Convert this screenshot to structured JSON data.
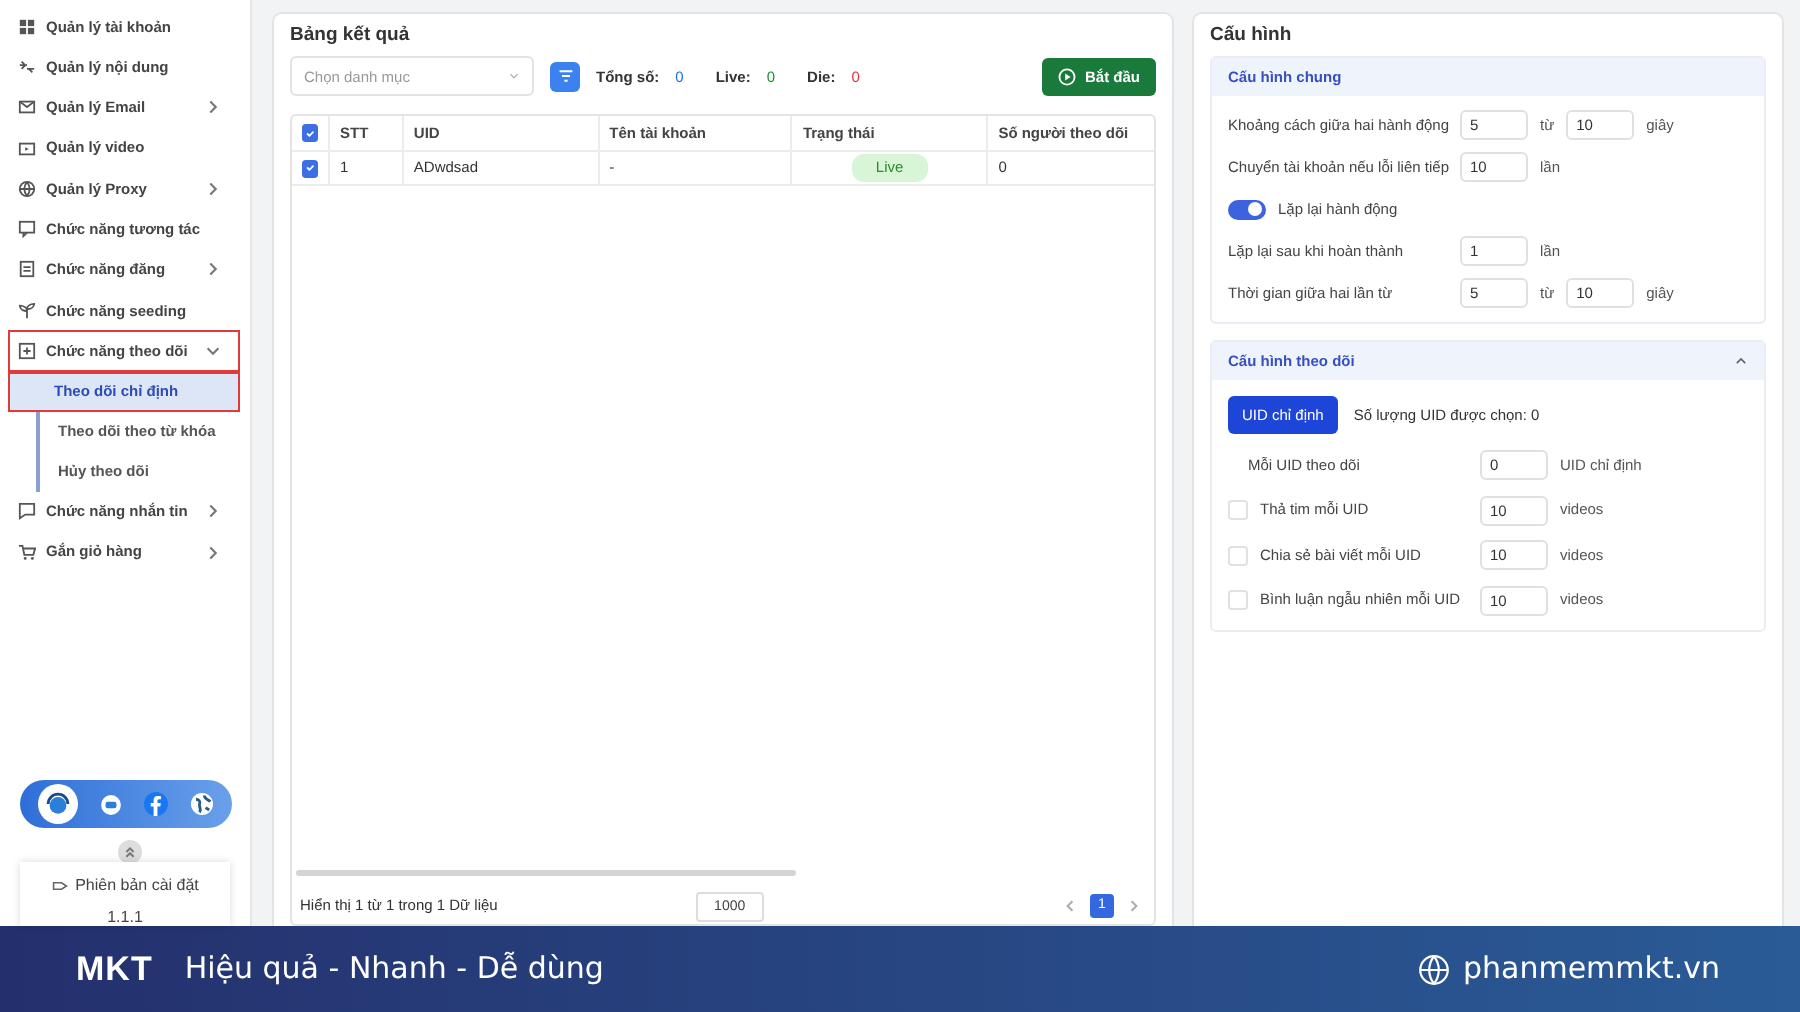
{
  "sidebar": {
    "items": [
      {
        "label": "Quản lý tài khoản",
        "outlined": false
      },
      {
        "label": "Quản lý nội dung",
        "outlined": false
      },
      {
        "label": "Quản lý Email",
        "expanded": false,
        "outlined": false
      },
      {
        "label": "Quản lý video",
        "outlined": false
      },
      {
        "label": "Quản lý Proxy",
        "expanded": false,
        "outlined": false
      },
      {
        "label": "Chức năng tương tác",
        "outlined": false
      },
      {
        "label": "Chức năng đăng",
        "expanded": false,
        "outlined": false
      },
      {
        "label": "Chức năng seeding",
        "outlined": false
      },
      {
        "label": "Chức năng theo dõi",
        "expanded": true,
        "outlined": true,
        "children": [
          {
            "label": "Theo dõi chỉ định",
            "selected": true,
            "outlined": true
          },
          {
            "label": "Theo dõi theo từ khóa",
            "selected": false,
            "outlined": false
          },
          {
            "label": "Hủy theo dõi",
            "selected": false,
            "outlined": false
          }
        ]
      },
      {
        "label": "Chức năng nhắn tin",
        "expanded": false,
        "outlined": false
      },
      {
        "label": "Gắn giỏ hàng",
        "expanded": false,
        "outlined": false
      }
    ],
    "version": {
      "label": "Phiên bản cài đặt",
      "number": "1.1.1"
    }
  },
  "results": {
    "title": "Bảng kết quả",
    "category_select": {
      "placeholder": "Chọn danh mục"
    },
    "stats": [
      {
        "label": "Tổng số:",
        "value": "0",
        "color": "#1e6fe0"
      },
      {
        "label": "Live:",
        "value": "0",
        "color": "#1a8a3a"
      },
      {
        "label": "Die:",
        "value": "0",
        "color": "#e0343a"
      }
    ],
    "start_button": "Bắt đầu",
    "table": {
      "all_checked": true,
      "columns": [
        "STT",
        "UID",
        "Tên tài khoản",
        "Trạng thái",
        "Số người theo dõi"
      ],
      "rows": [
        {
          "checked": true,
          "cells": [
            "1",
            "ADwdsad",
            "-",
            "Live",
            "0"
          ]
        }
      ]
    },
    "footer": {
      "summary": "Hiển thị 1 từ 1 trong 1 Dữ liệu",
      "page_size": "1000",
      "pages": [
        {
          "label": "1",
          "selected": true
        }
      ]
    }
  },
  "config": {
    "title": "Cấu hình",
    "sections": [
      {
        "title": "Cấu hình chung",
        "rows": [
          {
            "kind": "range",
            "label": "Khoảng cách giữa hai hành động",
            "from": "5",
            "between": "từ",
            "to": "10",
            "unit": "giây"
          },
          {
            "kind": "single",
            "label": "Chuyển tài khoản nếu lỗi liên tiếp",
            "value": "10",
            "unit": "lần"
          },
          {
            "kind": "toggle",
            "label": "Lặp lại hành động",
            "on": true
          },
          {
            "kind": "single",
            "label": "Lặp lại sau khi hoàn thành",
            "value": "1",
            "unit": "lần"
          },
          {
            "kind": "range",
            "label": "Thời gian giữa hai lần từ",
            "from": "5",
            "between": "từ",
            "to": "10",
            "unit": "giây"
          }
        ]
      },
      {
        "title": "Cấu hình theo dõi",
        "expanded": true,
        "mode_button": "UID chỉ định",
        "selected_count": "Số lượng UID được chọn: 0",
        "rows": [
          {
            "kind": "plain",
            "label": "Mỗi UID theo dõi",
            "value": "0",
            "unit": "UID chỉ định"
          },
          {
            "kind": "check",
            "label": "Thả tim mỗi UID",
            "checked": false,
            "value": "10",
            "unit": "videos"
          },
          {
            "kind": "check",
            "label": "Chia sẻ bài viết mỗi UID",
            "checked": false,
            "value": "10",
            "unit": "videos"
          },
          {
            "kind": "check",
            "label": "Bình luận ngẫu nhiên mỗi UID",
            "checked": false,
            "value": "10",
            "unit": "videos"
          }
        ]
      }
    ]
  },
  "banner": {
    "logo": "MKT",
    "tagline": "Hiệu quả - Nhanh - Dễ dùng",
    "website": "phanmemmkt.vn"
  }
}
